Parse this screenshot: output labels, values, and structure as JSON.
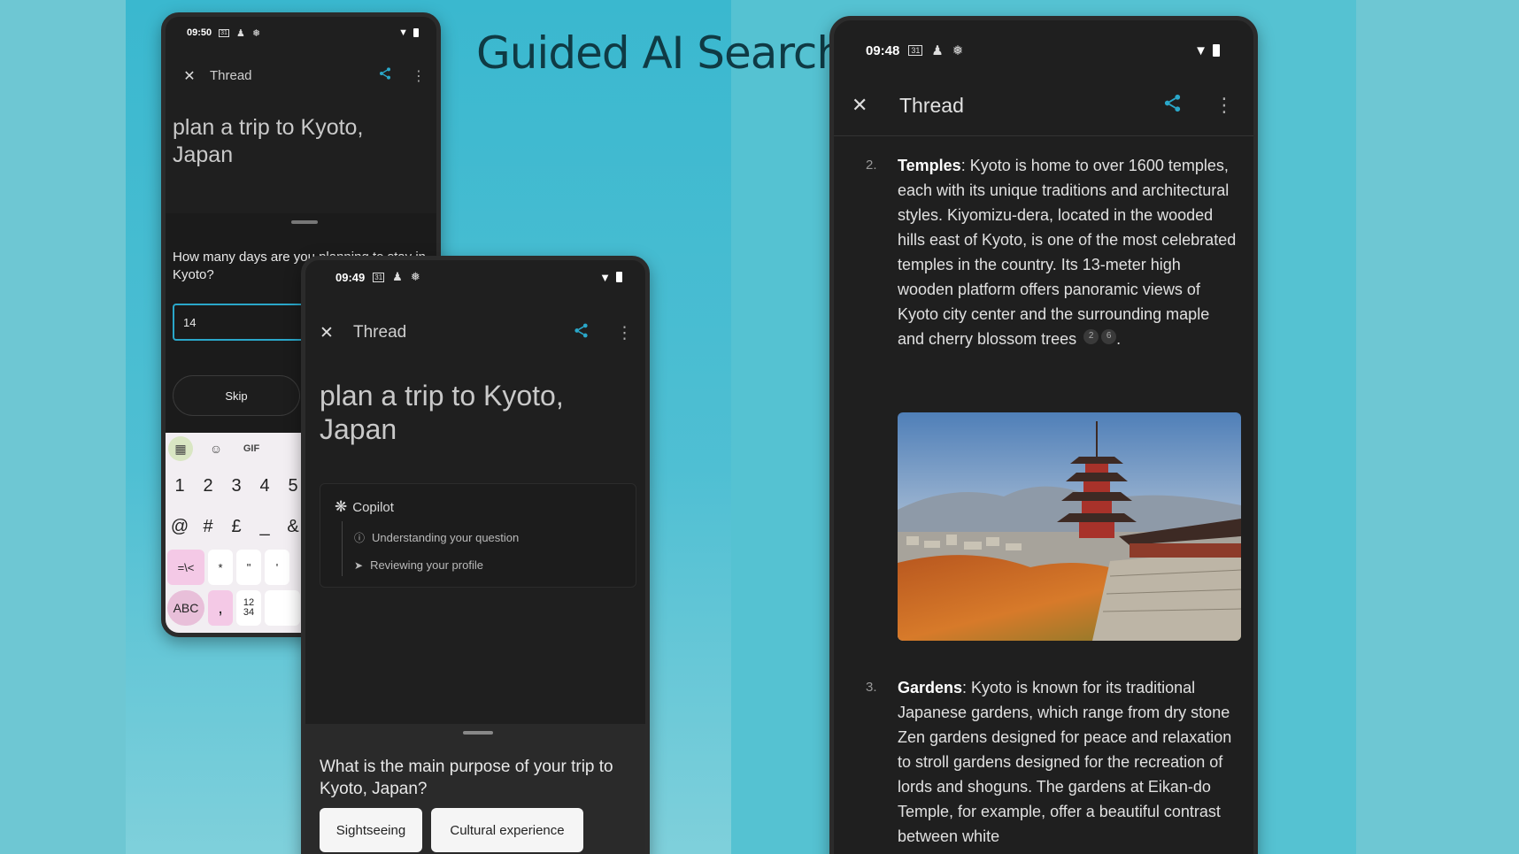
{
  "headline": "Guided AI Search",
  "status_icons": {
    "calendar": "31",
    "person": "person-icon",
    "fan": "fan-icon",
    "wifi": "wifi-icon",
    "battery": "battery-icon"
  },
  "phone1": {
    "time": "09:50",
    "title": "Thread",
    "query": "plan a trip to Kyoto, Japan",
    "question": "How many days are you planning to stay in Kyoto?",
    "answer": "14",
    "skip_label": "Skip",
    "keyboard": {
      "gif_label": "GIF",
      "row1": [
        "1",
        "2",
        "3",
        "4",
        "5"
      ],
      "row2": [
        "@",
        "#",
        "£",
        "_",
        "&"
      ],
      "row3": [
        "=\\<",
        "*",
        "\"",
        "'"
      ],
      "abc_label": "ABC",
      "comma": ",",
      "frac": "12\n34"
    }
  },
  "phone2": {
    "time": "09:49",
    "title": "Thread",
    "query": "plan a trip to Kyoto, Japan",
    "copilot": {
      "label": "Copilot",
      "steps": [
        "Understanding your question",
        "Reviewing your profile"
      ]
    },
    "question": "What is the main purpose of your trip to Kyoto, Japan?",
    "chips": [
      "Sightseeing",
      "Cultural experience"
    ]
  },
  "phone3": {
    "time": "09:48",
    "title": "Thread",
    "items": [
      {
        "num": "2.",
        "heading": "Temples",
        "text": ": Kyoto is home to over 1600 temples, each with its unique traditions and architectural styles. Kiyomizu-dera, located in the wooded hills east of Kyoto, is one of the most celebrated temples in the country. Its 13-meter high wooden platform offers panoramic views of Kyoto city center and the surrounding maple and cherry blossom trees",
        "citations": [
          "2",
          "6"
        ],
        "end": "."
      },
      {
        "num": "3.",
        "heading": "Gardens",
        "text": ": Kyoto is known for its traditional Japanese gardens, which range from dry stone Zen gardens designed for peace and relaxation to stroll gardens designed for the recreation of lords and shoguns. The gardens at Eikan-do Temple, for example, offer a beautiful contrast between white"
      }
    ]
  },
  "colors": {
    "accent": "#2aa7c9",
    "background": "#6ec7d3",
    "phone": "#1f1f1f"
  }
}
